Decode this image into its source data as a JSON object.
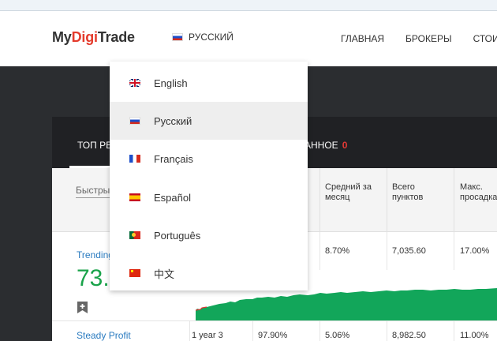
{
  "header": {
    "logo": {
      "part1": "My",
      "part2": "Digi",
      "part3": "Trade"
    },
    "language": {
      "current": "РУССКИЙ",
      "flag": "flag-ru"
    },
    "nav": [
      "ГЛАВНАЯ",
      "БРОКЕРЫ",
      "СТОИМ"
    ]
  },
  "tabs": {
    "top_label": "ТОП РЕ",
    "favorites_label": "АННОЕ",
    "favorites_count": "0"
  },
  "table": {
    "search_placeholder": "Быстрый",
    "columns": [
      {
        "line1": "Средний за",
        "line2": "месяц"
      },
      {
        "line1": "Всего",
        "line2": "пунктов"
      },
      {
        "line1": "Макс.",
        "line2": "просадка"
      }
    ],
    "rows": [
      {
        "name": "Trending",
        "score": "73.",
        "monthly": "8.70%",
        "points": "7,035.60",
        "drawdown": "17.00%"
      },
      {
        "name": "Steady Profit",
        "period": "1 year 3",
        "winrate": "97.90%",
        "monthly": "5.06%",
        "points": "8,982.50",
        "drawdown": "11.00%"
      }
    ]
  },
  "dropdown": {
    "items": [
      {
        "label": "English",
        "flag": "flag-gb",
        "selected": false
      },
      {
        "label": "Русский",
        "flag": "flag-ru",
        "selected": true
      },
      {
        "label": "Français",
        "flag": "flag-fr",
        "selected": false
      },
      {
        "label": "Español",
        "flag": "flag-es",
        "selected": false
      },
      {
        "label": "Português",
        "flag": "flag-pt",
        "selected": false
      },
      {
        "label": "中文",
        "flag": "flag-cn",
        "selected": false
      }
    ]
  },
  "colors": {
    "brand_accent": "#e43b2c",
    "link": "#2a7bc0",
    "positive": "#1aa34a",
    "dark_bg": "#2b2d30"
  }
}
